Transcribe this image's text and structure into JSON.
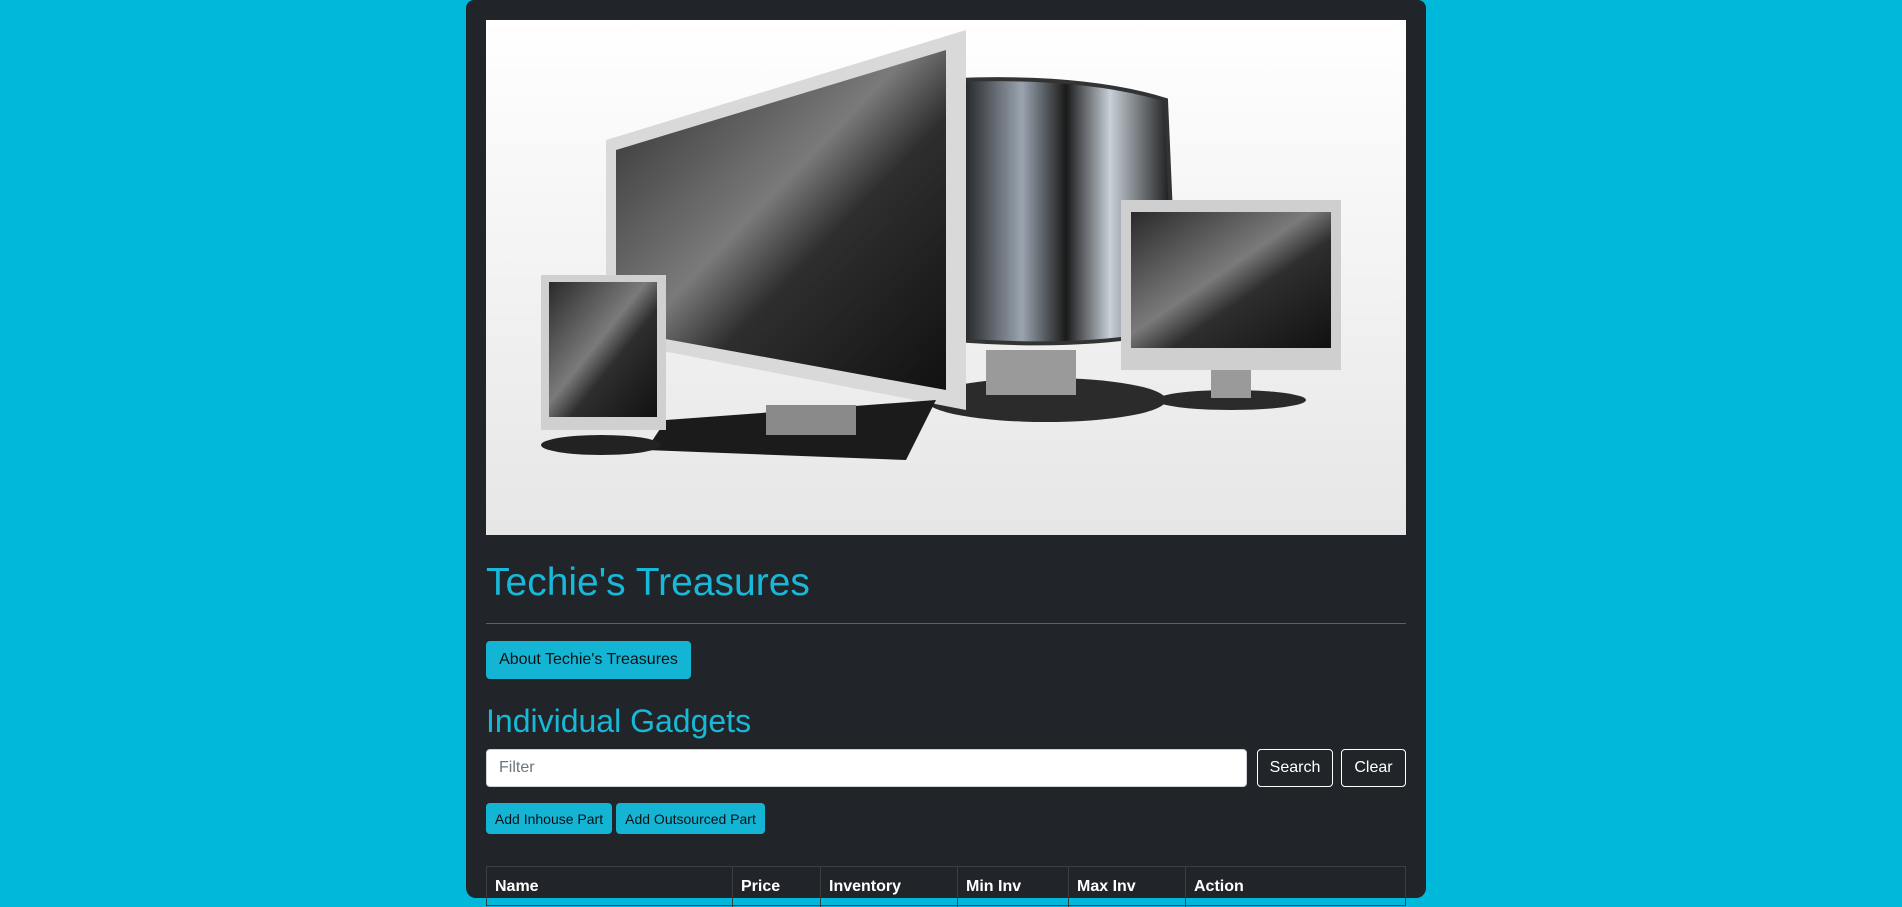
{
  "site": {
    "title": "Techie's Treasures",
    "about_button": "About Techie's Treasures"
  },
  "hero": {
    "image": "computer-monitors-illustration"
  },
  "parts": {
    "heading": "Individual Gadgets",
    "filter_placeholder": "Filter",
    "search_label": "Search",
    "clear_label": "Clear",
    "add_inhouse_label": "Add Inhouse Part",
    "add_outsourced_label": "Add Outsourced Part",
    "columns": [
      "Name",
      "Price",
      "Inventory",
      "Min Inv",
      "Max Inv",
      "Action"
    ]
  },
  "colors": {
    "page_bg": "#00b8d9",
    "card_bg": "#212529",
    "accent": "#17b8d8"
  }
}
